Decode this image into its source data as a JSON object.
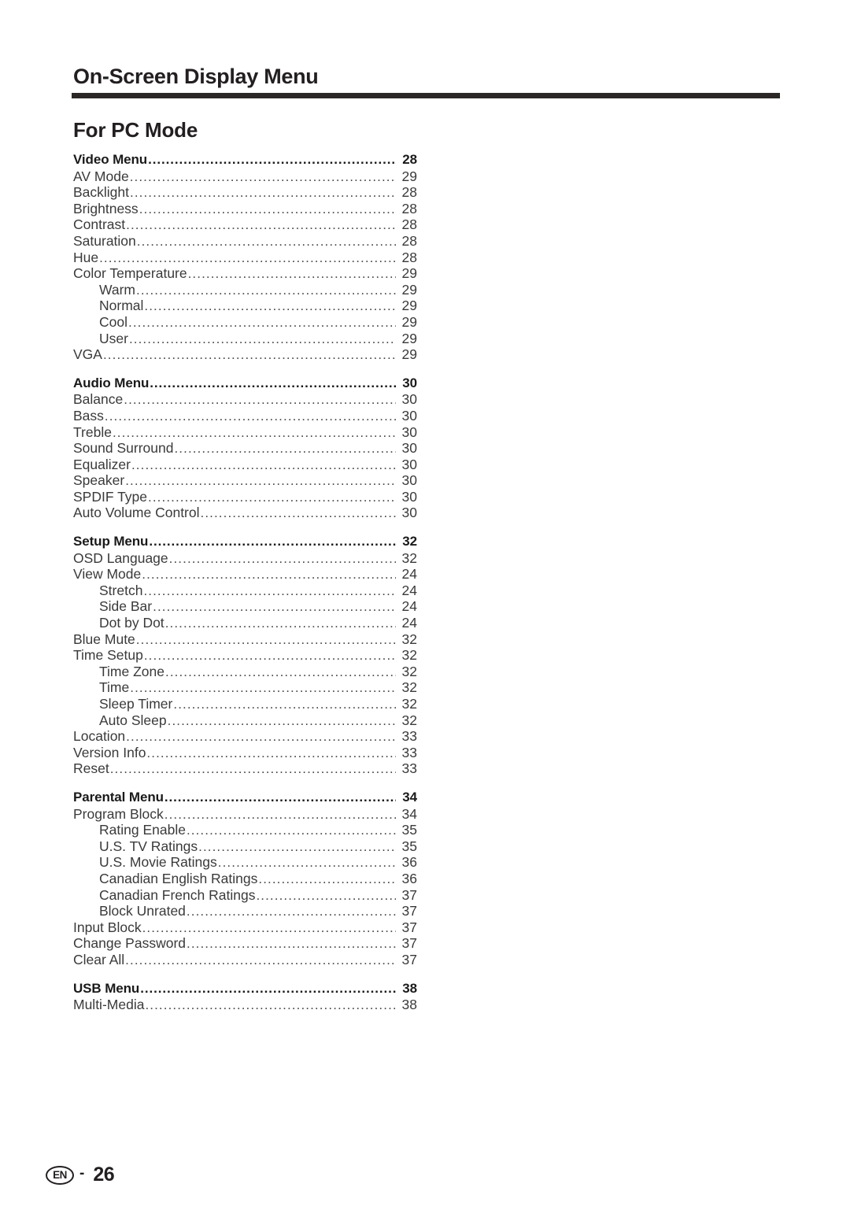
{
  "header": {
    "chapter_title": "On-Screen Display Menu",
    "section_title": "For PC Mode",
    "rule_color": "#2b2726"
  },
  "footer": {
    "language_badge": "EN",
    "separator": "-",
    "page_number": "26"
  },
  "toc": {
    "sections": [
      {
        "heading": {
          "label": "Video Menu",
          "page": "28"
        },
        "entries": [
          {
            "label": "AV Mode",
            "page": "29",
            "level": 1
          },
          {
            "label": "Backlight",
            "page": "28",
            "level": 1
          },
          {
            "label": "Brightness",
            "page": "28",
            "level": 1
          },
          {
            "label": "Contrast",
            "page": "28",
            "level": 1
          },
          {
            "label": "Saturation",
            "page": "28",
            "level": 1
          },
          {
            "label": "Hue",
            "page": "28",
            "level": 1
          },
          {
            "label": "Color Temperature",
            "page": "29",
            "level": 1
          },
          {
            "label": "Warm",
            "page": "29",
            "level": 2
          },
          {
            "label": "Normal",
            "page": "29",
            "level": 2
          },
          {
            "label": "Cool",
            "page": "29",
            "level": 2
          },
          {
            "label": "User",
            "page": "29",
            "level": 2
          },
          {
            "label": "VGA",
            "page": "29",
            "level": 1
          }
        ]
      },
      {
        "heading": {
          "label": "Audio Menu",
          "page": "30"
        },
        "entries": [
          {
            "label": "Balance",
            "page": "30",
            "level": 1
          },
          {
            "label": "Bass",
            "page": "30",
            "level": 1
          },
          {
            "label": "Treble",
            "page": "30",
            "level": 1
          },
          {
            "label": "Sound Surround",
            "page": "30",
            "level": 1
          },
          {
            "label": "Equalizer",
            "page": "30",
            "level": 1
          },
          {
            "label": "Speaker",
            "page": "30",
            "level": 1
          },
          {
            "label": "SPDIF Type",
            "page": "30",
            "level": 1
          },
          {
            "label": "Auto Volume Control",
            "page": "30",
            "level": 1
          }
        ]
      },
      {
        "heading": {
          "label": "Setup Menu",
          "page": "32"
        },
        "entries": [
          {
            "label": "OSD Language",
            "page": "32",
            "level": 1
          },
          {
            "label": "View Mode",
            "page": "24",
            "level": 1
          },
          {
            "label": "Stretch",
            "page": "24",
            "level": 2
          },
          {
            "label": "Side Bar",
            "page": "24",
            "level": 2
          },
          {
            "label": "Dot by Dot",
            "page": "24",
            "level": 2
          },
          {
            "label": "Blue Mute",
            "page": "32",
            "level": 1
          },
          {
            "label": "Time Setup",
            "page": "32",
            "level": 1
          },
          {
            "label": "Time Zone",
            "page": "32",
            "level": 2
          },
          {
            "label": "Time",
            "page": "32",
            "level": 2
          },
          {
            "label": "Sleep Timer",
            "page": "32",
            "level": 2
          },
          {
            "label": "Auto Sleep",
            "page": "32",
            "level": 2
          },
          {
            "label": "Location",
            "page": "33",
            "level": 1
          },
          {
            "label": "Version Info",
            "page": "33",
            "level": 1
          },
          {
            "label": "Reset",
            "page": "33",
            "level": 1
          }
        ]
      },
      {
        "heading": {
          "label": "Parental Menu",
          "page": "34"
        },
        "entries": [
          {
            "label": "Program Block",
            "page": "34",
            "level": 1
          },
          {
            "label": "Rating Enable",
            "page": "35",
            "level": 2
          },
          {
            "label": "U.S. TV Ratings",
            "page": "35",
            "level": 2
          },
          {
            "label": "U.S. Movie Ratings",
            "page": "36",
            "level": 2
          },
          {
            "label": "Canadian English Ratings",
            "page": "36",
            "level": 2
          },
          {
            "label": "Canadian French Ratings",
            "page": "37",
            "level": 2
          },
          {
            "label": "Block Unrated",
            "page": "37",
            "level": 2
          },
          {
            "label": "Input Block",
            "page": "37",
            "level": 1
          },
          {
            "label": "Change Password",
            "page": "37",
            "level": 1
          },
          {
            "label": "Clear All",
            "page": "37",
            "level": 1
          }
        ]
      },
      {
        "heading": {
          "label": "USB Menu",
          "page": "38"
        },
        "entries": [
          {
            "label": "Multi-Media",
            "page": "38",
            "level": 1
          }
        ]
      }
    ]
  }
}
